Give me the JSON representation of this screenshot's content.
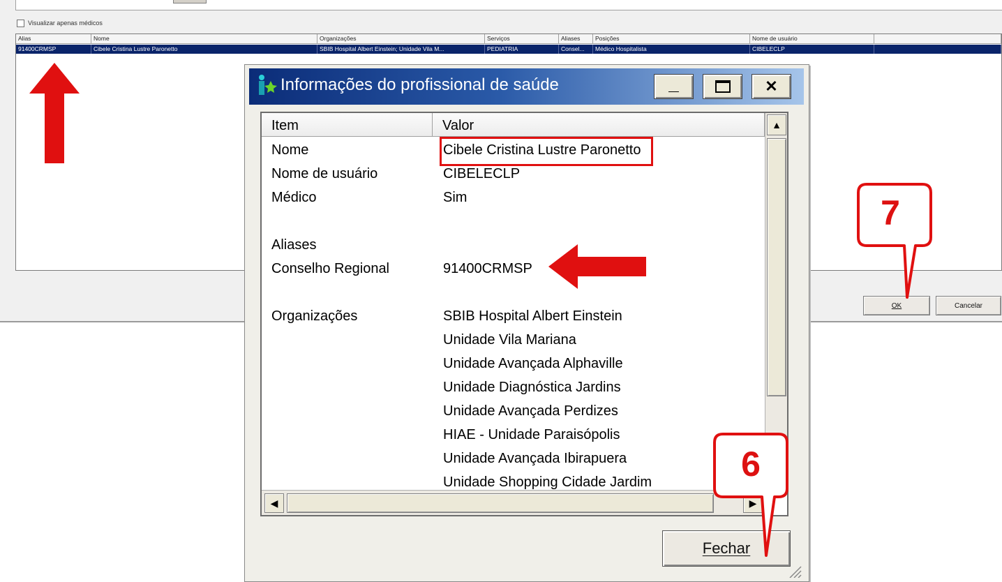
{
  "background": {
    "checkbox_label": "Visualizar apenas médicos",
    "columns": [
      "Alias",
      "Nome",
      "Organizações",
      "Serviços",
      "Aliases",
      "Posições",
      "Nome de usuário"
    ],
    "selected_row": [
      "91400CRMSP",
      "Cibele Cristina Lustre Paronetto",
      "SBIB Hospital Albert Einstein; Unidade Vila M...",
      "PEDIATRIA",
      "Consel...",
      "Médico Hospitalista",
      "CIBELECLP"
    ],
    "ok_label": "OK",
    "cancel_label": "Cancelar"
  },
  "dialog": {
    "title": "Informações do profissional de saúde",
    "minimize": "_",
    "maximize": "☐",
    "close": "✕",
    "columns": {
      "item": "Item",
      "value": "Valor"
    },
    "rows": [
      {
        "item": "Nome",
        "value": "Cibele Cristina Lustre Paronetto"
      },
      {
        "item": "Nome de usuário",
        "value": "CIBELECLP"
      },
      {
        "item": "Médico",
        "value": "Sim"
      },
      {
        "item": "Aliases",
        "value": ""
      },
      {
        "item": "Conselho Regional",
        "value": "91400CRMSP"
      },
      {
        "item": "Organizações",
        "value": "SBIB Hospital Albert Einstein"
      },
      {
        "item": "",
        "value": "Unidade Vila Mariana"
      },
      {
        "item": "",
        "value": "Unidade Avançada Alphaville"
      },
      {
        "item": "",
        "value": "Unidade Diagnóstica Jardins"
      },
      {
        "item": "",
        "value": "Unidade Avançada Perdizes"
      },
      {
        "item": "",
        "value": "HIAE - Unidade Paraisópolis"
      },
      {
        "item": "",
        "value": "Unidade Avançada Ibirapuera"
      },
      {
        "item": "",
        "value": "Unidade Shopping Cidade Jardim"
      }
    ],
    "close_button_label": "Fechar"
  },
  "annotations": {
    "callout_ok": "7",
    "callout_close": "6",
    "accent_color": "#e01010"
  }
}
